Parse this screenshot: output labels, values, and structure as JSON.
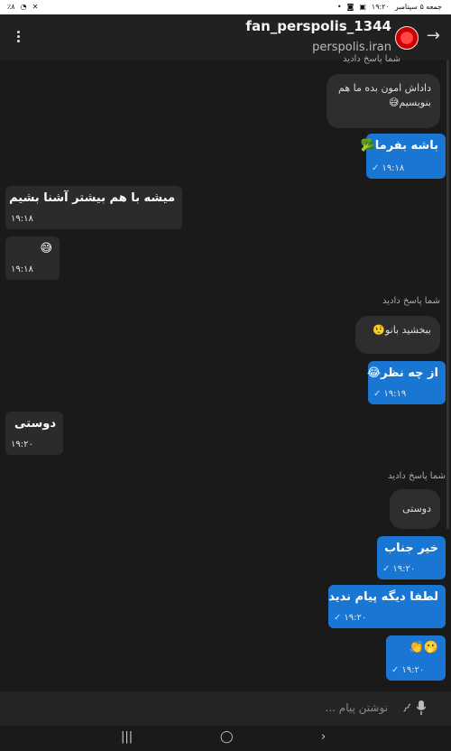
{
  "status_bar": {
    "left_items": [
      "٪۸",
      "wifi",
      "no-sound",
      "bluetooth-off"
    ],
    "clock": "۱۹:۲۰",
    "date": "جمعه ۵ سپتامبر",
    "right_icons": [
      "gallery-icon",
      "notification-icon",
      "dot"
    ]
  },
  "header": {
    "title": "fan_perspolis_1344",
    "subtitle": "perspolis.iran",
    "back_icon": "arrow-right-icon",
    "menu_icon": "more-vert-icon"
  },
  "messages": [
    {
      "id": "r1-label",
      "type": "reply_label",
      "text": "شما پاسخ دادید"
    },
    {
      "id": "r1-quote",
      "type": "quote",
      "text": "داداش امون بده ما هم بنویسیم😅"
    },
    {
      "id": "m1",
      "type": "out",
      "text": "باشه بفرما🥦",
      "time": "۱۹:۱۸",
      "status": "sent"
    },
    {
      "id": "m2",
      "type": "in",
      "text": "میشه با هم بیشتر آشنا بشیم",
      "time": "۱۹:۱۸"
    },
    {
      "id": "m3",
      "type": "in",
      "text": "😅",
      "time": "۱۹:۱۸"
    },
    {
      "id": "r2-label",
      "type": "reply_label",
      "text": "شما پاسخ دادید"
    },
    {
      "id": "r2-quote",
      "type": "quote",
      "text": "ببخشید بانو🤨"
    },
    {
      "id": "m4",
      "type": "out",
      "text": "از چه نظر😂",
      "time": "۱۹:۱۹",
      "status": "sent"
    },
    {
      "id": "m5",
      "type": "in",
      "text": "دوستی",
      "time": "۱۹:۲۰"
    },
    {
      "id": "r3-label",
      "type": "reply_label",
      "text": "شما پاسخ دادید"
    },
    {
      "id": "r3-quote",
      "type": "quote",
      "text": "دوستی"
    },
    {
      "id": "m6",
      "type": "out",
      "text": "خیر جناب",
      "time": "۱۹:۲۰",
      "status": "sent"
    },
    {
      "id": "m7",
      "type": "out",
      "text": "لطفا دیگه پیام ندید",
      "time": "۱۹:۲۰",
      "status": "sent"
    },
    {
      "id": "m8",
      "type": "out",
      "text": "🫢👏",
      "time": "۱۹:۲۰",
      "status": "sent"
    }
  ],
  "composer": {
    "placeholder": "نوشتن پیام ...",
    "mic_icon": "mic-icon",
    "attach_icon": "paperclip-icon"
  },
  "nav_bar": {
    "buttons": [
      "recents",
      "home",
      "back"
    ]
  },
  "colors": {
    "outgoing_bubble": "#1976d2",
    "incoming_bubble": "#2b2b2b",
    "background": "#1a1a1a"
  }
}
